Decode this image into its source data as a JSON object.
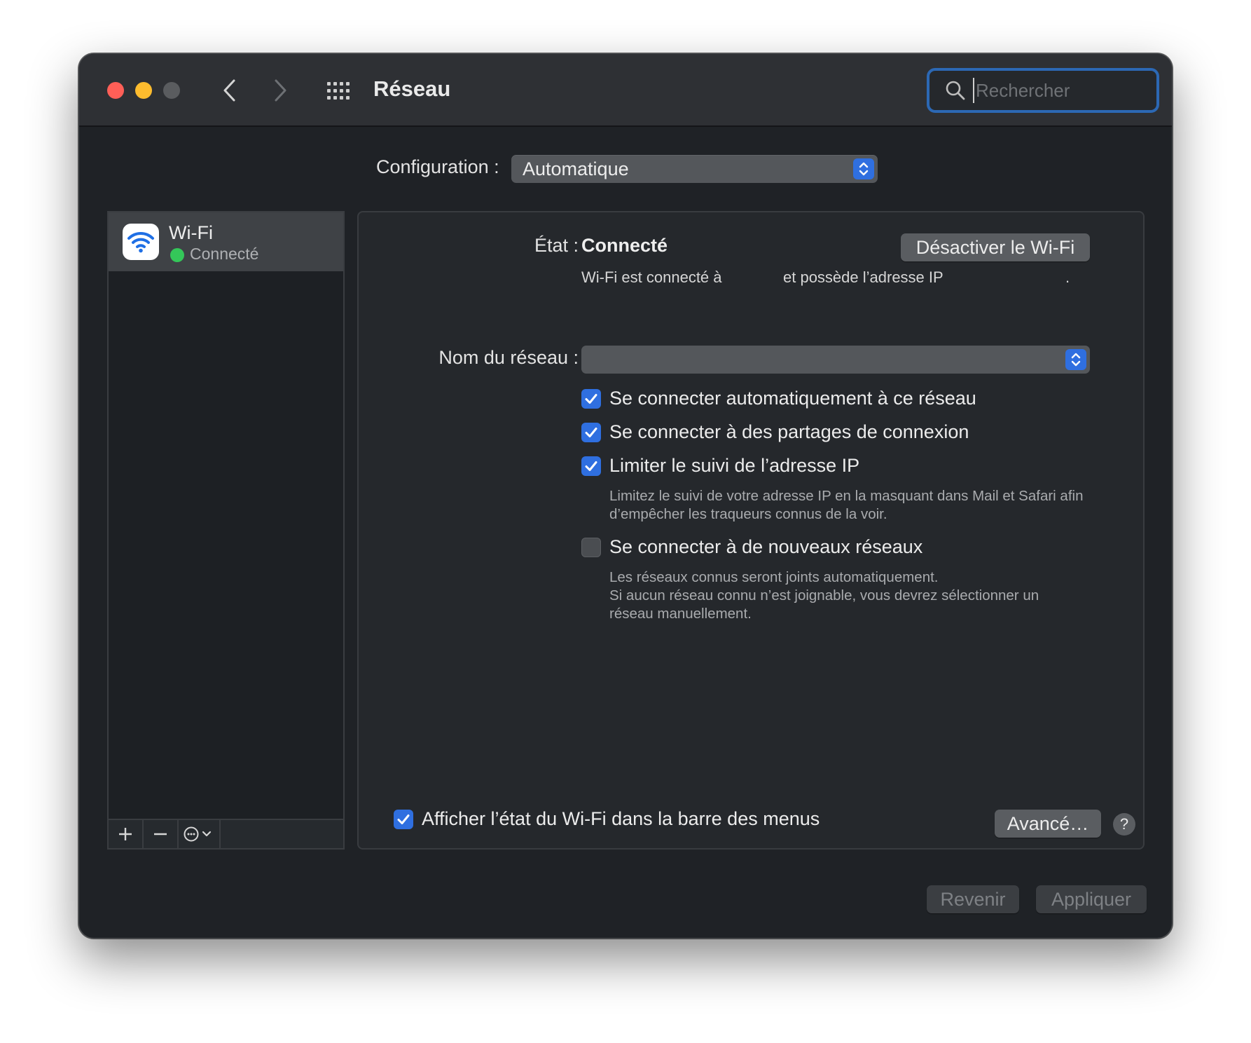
{
  "window": {
    "title": "Réseau",
    "search_placeholder": "Rechercher"
  },
  "configuration": {
    "label": "Configuration :",
    "value": "Automatique"
  },
  "sidebar": {
    "items": [
      {
        "name": "Wi-Fi",
        "status": "Connecté",
        "status_color": "#34c759",
        "icon": "wifi-icon"
      }
    ],
    "footer": {
      "add": "+",
      "remove": "−",
      "action": "action-menu-icon"
    }
  },
  "panel": {
    "state_label": "État :",
    "state_value": "Connecté",
    "disable_button": "Désactiver le Wi-Fi",
    "state_desc_a": "Wi-Fi est connecté à",
    "state_desc_b": "et possède l’adresse IP",
    "state_desc_c": ".",
    "network_name_label": "Nom du réseau :",
    "network_name_value": "",
    "options": [
      {
        "label": "Se connecter automatiquement à ce réseau",
        "checked": true
      },
      {
        "label": "Se connecter à des partages de connexion",
        "checked": true
      },
      {
        "label": "Limiter le suivi de l’adresse IP",
        "checked": true
      },
      {
        "label": "Se connecter à de nouveaux réseaux",
        "checked": false
      }
    ],
    "limit_help": [
      "Limitez le suivi de votre adresse IP en la masquant dans Mail et Safari afin",
      "d’empêcher les traqueurs connus de la voir."
    ],
    "new_help": [
      "Les réseaux connus seront joints automatiquement.",
      "Si aucun réseau connu n’est joignable, vous devrez sélectionner un",
      "réseau manuellement."
    ],
    "show_menu_bar": {
      "label": "Afficher l’état du Wi-Fi dans la barre des menus",
      "checked": true
    },
    "advanced_button": "Avancé…",
    "help_button": "?"
  },
  "footer": {
    "revert_button": "Revenir",
    "apply_button": "Appliquer"
  },
  "colors": {
    "accent": "#2f6fe0",
    "close": "#ff5f57",
    "minimize": "#febc2e",
    "search_focus": "#2c68b4"
  }
}
